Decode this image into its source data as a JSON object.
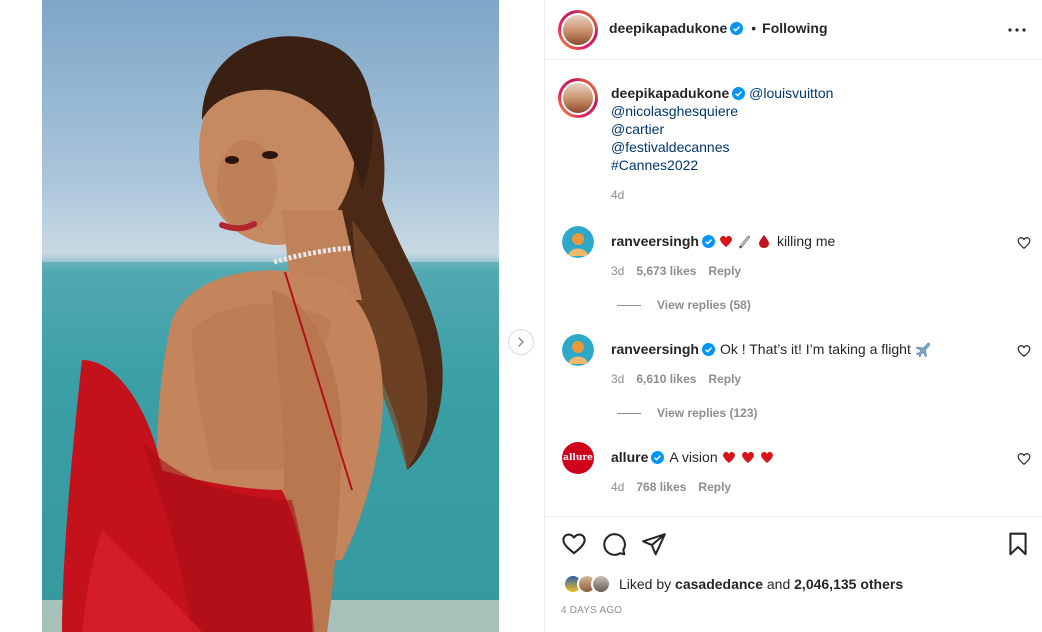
{
  "post": {
    "author": "deepikapadukone",
    "follow_separator": "•",
    "follow_status": "Following",
    "caption": {
      "author": "deepikapadukone",
      "lines": [
        "@louisvuitton",
        "@nicolasghesquiere",
        "@cartier",
        "@festivaldecannes",
        "#Cannes2022"
      ],
      "time": "4d"
    },
    "comments": [
      {
        "user": "ranveersingh",
        "emojis": [
          "red-heart",
          "knife",
          "blood-drop"
        ],
        "text": "killing me",
        "time": "3d",
        "likes": "5,673 likes",
        "reply": "Reply",
        "view_replies": "View replies (58)"
      },
      {
        "user": "ranveersingh",
        "text": "Ok ! That’s it! I’m taking a flight",
        "emojis_after": [
          "airplane"
        ],
        "time": "3d",
        "likes": "6,610 likes",
        "reply": "Reply",
        "view_replies": "View replies (123)"
      },
      {
        "user": "allure",
        "avatar_text": "allure",
        "text": "A vision",
        "emojis_after": [
          "red-heart",
          "red-heart",
          "red-heart"
        ],
        "time": "4d",
        "likes": "768 likes",
        "reply": "Reply"
      }
    ],
    "liked_by": {
      "prefix": "Liked by",
      "user": "casadedance",
      "and": "and",
      "count": "2,046,135 others"
    },
    "post_time": "4 DAYS AGO"
  },
  "colors": {
    "verified": "#0095f6",
    "link": "#00376b",
    "secondary_text": "#8e8e8e",
    "heart": "#ed4956",
    "allure_red": "#d0021b"
  }
}
